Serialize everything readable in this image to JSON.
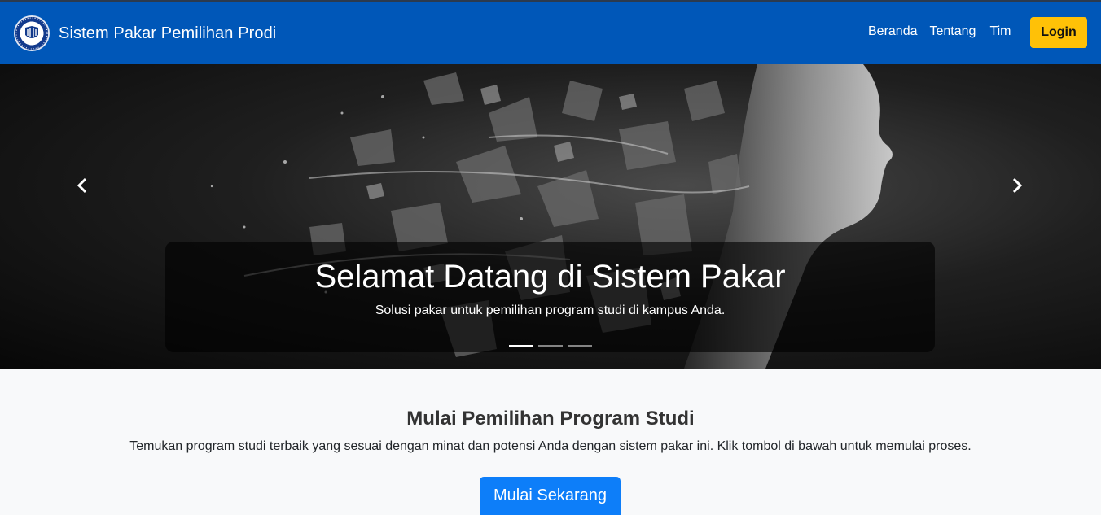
{
  "navbar": {
    "brand": "Sistem Pakar Pemilihan Prodi",
    "logo_icon": "university-seal-logo",
    "links": [
      "Beranda",
      "Tentang",
      "Tim"
    ],
    "login_label": "Login",
    "background": "#0057b8",
    "login_color": "#ffc107"
  },
  "carousel": {
    "title": "Selamat Datang di Sistem Pakar",
    "subtitle": "Solusi pakar untuk pemilihan program studi di kampus Anda.",
    "prev_icon": "chevron-left-icon",
    "next_icon": "chevron-right-icon",
    "slide_count": 3,
    "active_slide": 1
  },
  "main": {
    "title": "Mulai Pemilihan Program Studi",
    "description": "Temukan program studi terbaik yang sesuai dengan minat dan potensi Anda dengan sistem pakar ini. Klik tombol di bawah untuk memulai proses.",
    "button_label": "Mulai Sekarang",
    "button_color": "#0d7ef9"
  }
}
